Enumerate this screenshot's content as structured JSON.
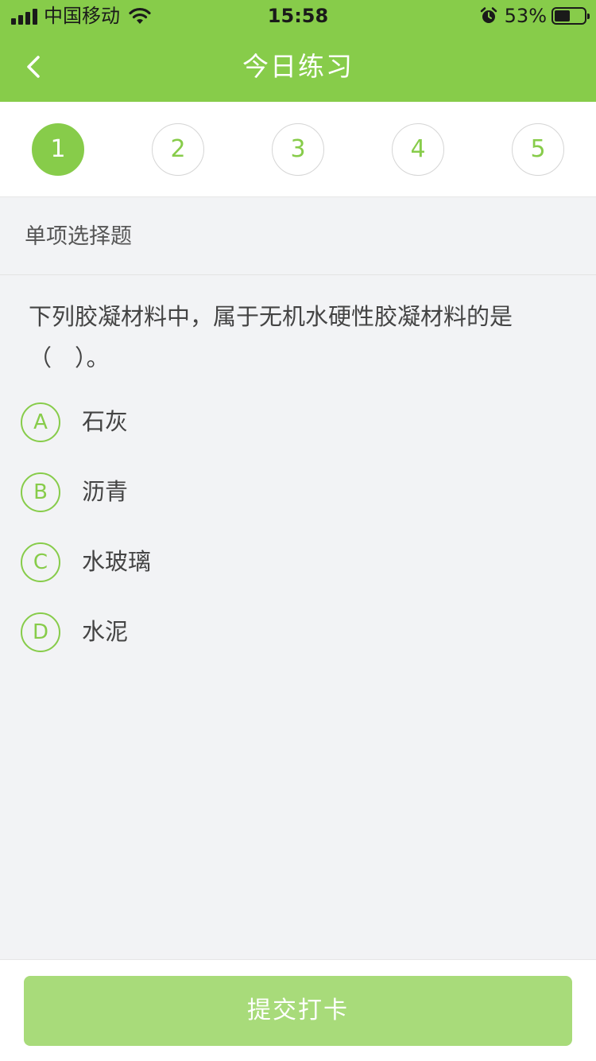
{
  "status_bar": {
    "carrier": "中国移动",
    "time": "15:58",
    "battery_percent": "53%",
    "battery_level": 0.53,
    "icons": [
      "signal-icon",
      "wifi-icon",
      "alarm-icon",
      "battery-icon"
    ]
  },
  "nav": {
    "title": "今日练习",
    "back_icon": "chevron-left-icon"
  },
  "question_numbers": [
    "1",
    "2",
    "3",
    "4",
    "5"
  ],
  "active_question": "1",
  "section": {
    "type_label": "单项选择题"
  },
  "question": {
    "text": "下列胶凝材料中，属于无机水硬性胶凝材料的是（　）。",
    "options": [
      {
        "letter": "A",
        "text": "石灰"
      },
      {
        "letter": "B",
        "text": "沥青"
      },
      {
        "letter": "C",
        "text": "水玻璃"
      },
      {
        "letter": "D",
        "text": "水泥"
      }
    ]
  },
  "footer": {
    "submit_label": "提交打卡"
  },
  "colors": {
    "brand_green": "#87cc4a",
    "button_green": "#a8db7a",
    "background": "#f2f3f5"
  }
}
